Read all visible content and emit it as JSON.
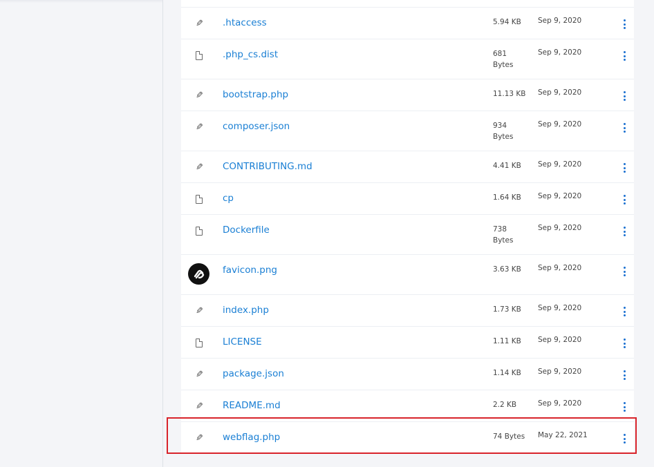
{
  "files": [
    {
      "icon": "pencil-icon",
      "name": ".htaccess",
      "size": "5.94 KB",
      "date": "Sep 9, 2020",
      "tall": false
    },
    {
      "icon": "file-icon",
      "name": ".php_cs.dist",
      "size": "681 Bytes",
      "date": "Sep 9, 2020",
      "tall": true
    },
    {
      "icon": "pencil-icon",
      "name": "bootstrap.php",
      "size": "11.13 KB",
      "date": "Sep 9, 2020",
      "tall": false
    },
    {
      "icon": "pencil-icon",
      "name": "composer.json",
      "size": "934 Bytes",
      "date": "Sep 9, 2020",
      "tall": true
    },
    {
      "icon": "pencil-icon",
      "name": "CONTRIBUTING.md",
      "size": "4.41 KB",
      "date": "Sep 9, 2020",
      "tall": false
    },
    {
      "icon": "file-icon",
      "name": "cp",
      "size": "1.64 KB",
      "date": "Sep 9, 2020",
      "tall": false
    },
    {
      "icon": "file-icon",
      "name": "Dockerfile",
      "size": "738 Bytes",
      "date": "Sep 9, 2020",
      "tall": true
    },
    {
      "icon": "image-thumbnail-icon",
      "name": "favicon.png",
      "size": "3.63 KB",
      "date": "Sep 9, 2020",
      "tall": true
    },
    {
      "icon": "pencil-icon",
      "name": "index.php",
      "size": "1.73 KB",
      "date": "Sep 9, 2020",
      "tall": false
    },
    {
      "icon": "file-icon",
      "name": "LICENSE",
      "size": "1.11 KB",
      "date": "Sep 9, 2020",
      "tall": false
    },
    {
      "icon": "pencil-icon",
      "name": "package.json",
      "size": "1.14 KB",
      "date": "Sep 9, 2020",
      "tall": false
    },
    {
      "icon": "pencil-icon",
      "name": "README.md",
      "size": "2.2 KB",
      "date": "Sep 9, 2020",
      "tall": false
    },
    {
      "icon": "pencil-icon",
      "name": "webflag.php",
      "size": "74 Bytes",
      "date": "May 22, 2021",
      "tall": false,
      "highlighted": true
    }
  ],
  "colors": {
    "link": "#1a7fd4",
    "menu_dots": "#1a6fd0",
    "highlight_border": "#d8232a",
    "background": "#f4f5f8"
  }
}
